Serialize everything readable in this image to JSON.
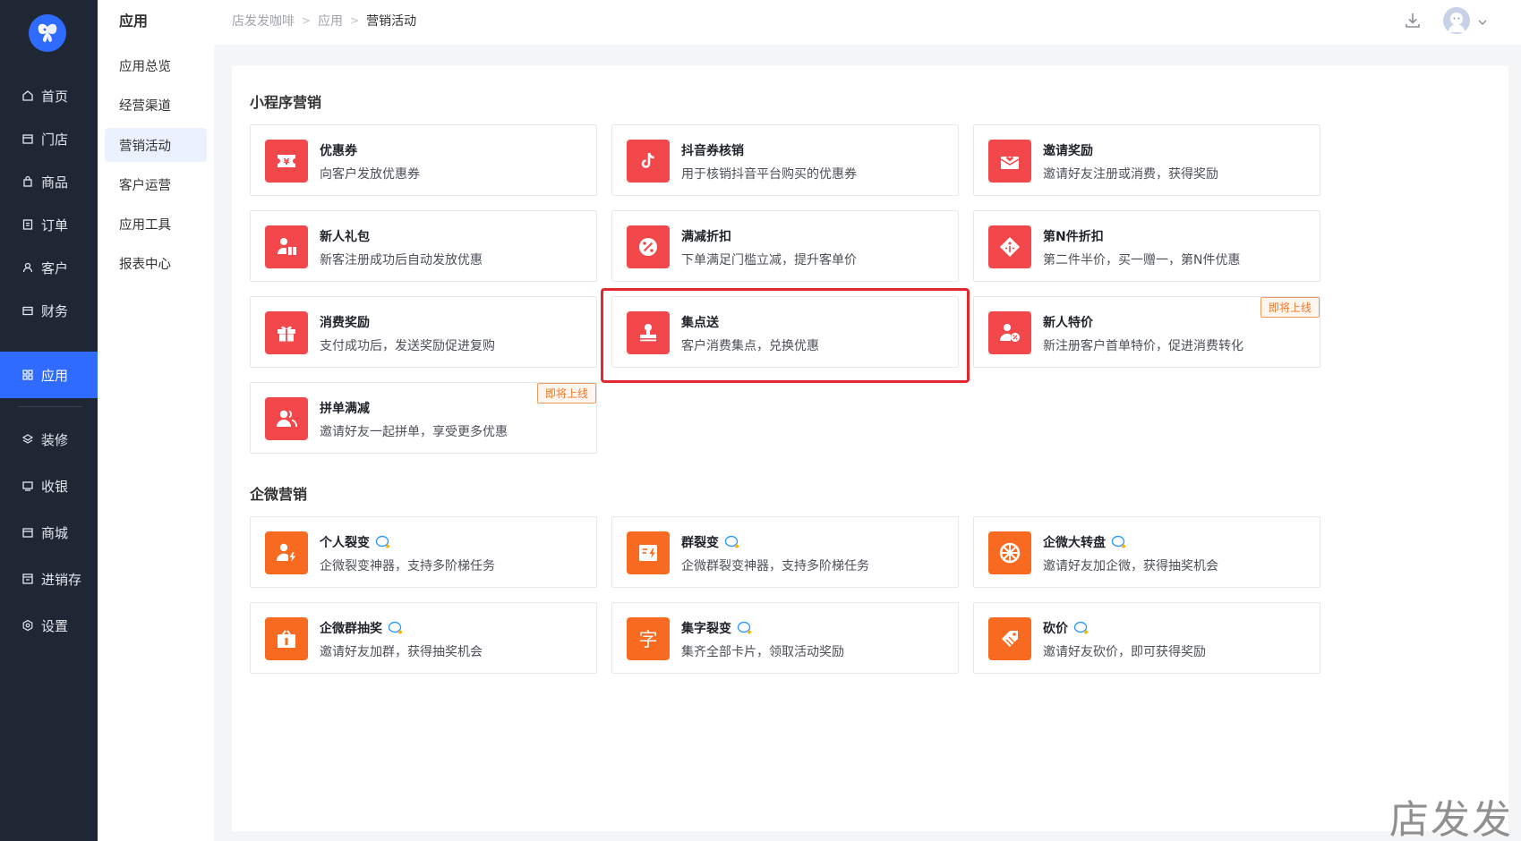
{
  "sidebar": {
    "items": [
      {
        "label": "首页",
        "icon": "home-icon"
      },
      {
        "label": "门店",
        "icon": "store-icon"
      },
      {
        "label": "商品",
        "icon": "bag-icon"
      },
      {
        "label": "订单",
        "icon": "order-icon"
      },
      {
        "label": "客户",
        "icon": "user-icon"
      },
      {
        "label": "财务",
        "icon": "wallet-icon"
      },
      {
        "label": "应用",
        "icon": "apps-icon",
        "active": true
      },
      {
        "label": "装修",
        "icon": "layers-icon"
      },
      {
        "label": "收银",
        "icon": "cashier-icon"
      },
      {
        "label": "商城",
        "icon": "mall-icon"
      },
      {
        "label": "进销存",
        "icon": "inventory-icon"
      },
      {
        "label": "设置",
        "icon": "gear-icon"
      }
    ],
    "active_color": "#2f6bff"
  },
  "subnav": {
    "title": "应用",
    "items": [
      "应用总览",
      "经营渠道",
      "营销活动",
      "客户运营",
      "应用工具",
      "报表中心"
    ],
    "active_index": 2
  },
  "breadcrumb": [
    "店发发咖啡",
    "应用",
    "营销活动"
  ],
  "sections": {
    "mini": {
      "title": "小程序营销",
      "cards": [
        {
          "title": "优惠券",
          "desc": "向客户发放优惠券",
          "icon": "coupon-icon"
        },
        {
          "title": "抖音券核销",
          "desc": "用于核销抖音平台购买的优惠券",
          "icon": "tiktok-icon"
        },
        {
          "title": "邀请奖励",
          "desc": "邀请好友注册或消费，获得奖励",
          "icon": "invite-mail-icon"
        },
        {
          "title": "新人礼包",
          "desc": "新客注册成功后自动发放优惠",
          "icon": "newbie-gift-icon"
        },
        {
          "title": "满减折扣",
          "desc": "下单满足门槛立减，提升客单价",
          "icon": "discount-icon"
        },
        {
          "title": "第N件折扣",
          "desc": "第二件半价，买一赠一，第N件优惠",
          "icon": "price-tag-icon"
        },
        {
          "title": "消费奖励",
          "desc": "支付成功后，发送奖励促进复购",
          "icon": "gift-icon"
        },
        {
          "title": "集点送",
          "desc": "客户消费集点，兑换优惠",
          "icon": "stamp-icon"
        },
        {
          "title": "新人特价",
          "desc": "新注册客户首单特价，促进消费转化",
          "icon": "newbie-discount-icon",
          "badge": "即将上线"
        },
        {
          "title": "拼单满减",
          "desc": "邀请好友一起拼单，享受更多优惠",
          "icon": "group-users-icon",
          "badge": "即将上线"
        }
      ]
    },
    "wecom": {
      "title": "企微营销",
      "cards": [
        {
          "title": "个人裂变",
          "desc": "企微裂变神器，支持多阶梯任务",
          "icon": "person-flash-icon"
        },
        {
          "title": "群裂变",
          "desc": "企微群裂变神器，支持多阶梯任务",
          "icon": "group-flash-icon"
        },
        {
          "title": "企微大转盘",
          "desc": "邀请好友加企微，获得抽奖机会",
          "icon": "wheel-icon"
        },
        {
          "title": "企微群抽奖",
          "desc": "邀请好友加群，获得抽奖机会",
          "icon": "lottery-box-icon"
        },
        {
          "title": "集字裂变",
          "desc": "集齐全部卡片，领取活动奖励",
          "icon": "character-icon",
          "glyph": "字"
        },
        {
          "title": "砍价",
          "desc": "邀请好友砍价，即可获得奖励",
          "icon": "bargain-tag-icon"
        }
      ]
    }
  },
  "watermark": "店发发",
  "colors": {
    "red_icon": "#f2474b",
    "orange_icon": "#f86a1f",
    "highlight": "#e3282e",
    "badge": "#f0792c"
  }
}
